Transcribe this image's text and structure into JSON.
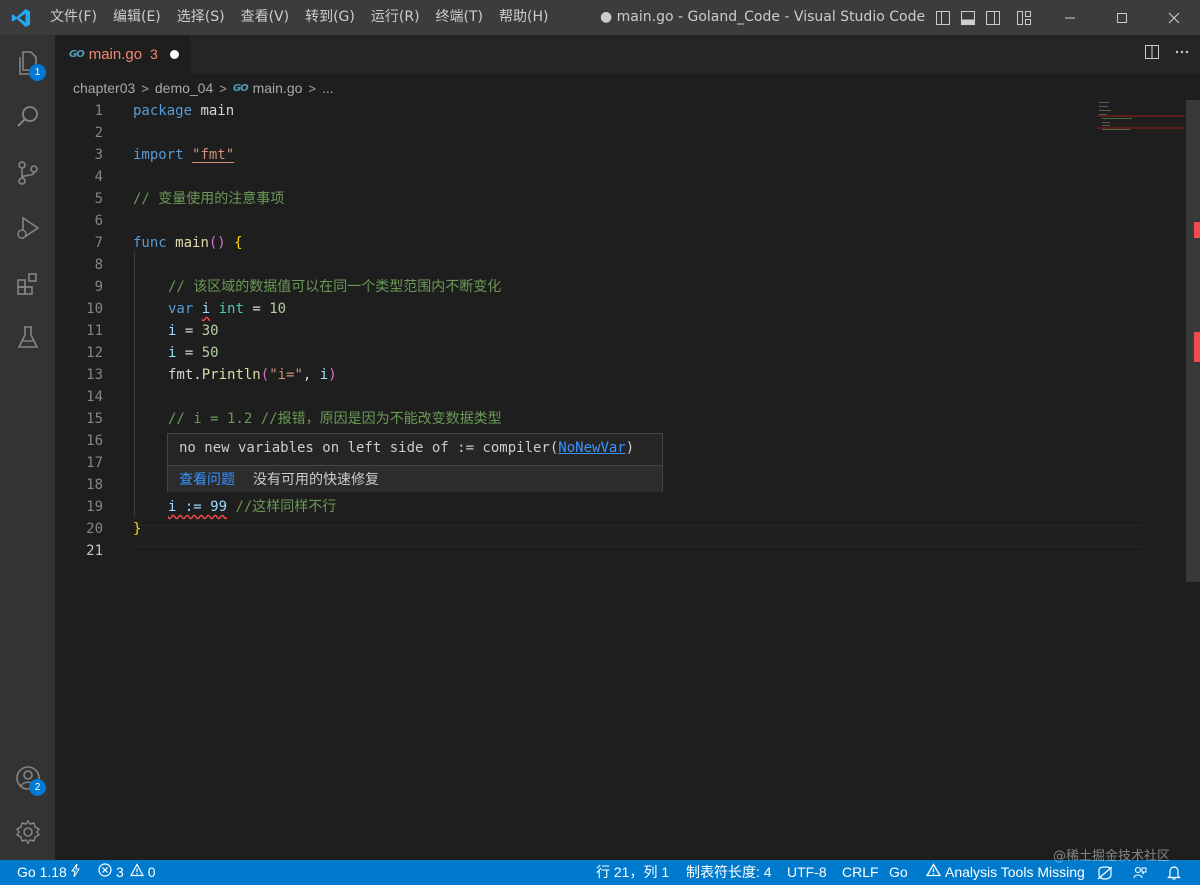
{
  "menubar": {
    "items": [
      "文件(F)",
      "编辑(E)",
      "选择(S)",
      "查看(V)",
      "转到(G)",
      "运行(R)",
      "终端(T)",
      "帮助(H)"
    ]
  },
  "window": {
    "title": "● main.go - Goland_Code - Visual Studio Code [管理..."
  },
  "activity": {
    "explorer_badge": "1",
    "accounts_badge": "2"
  },
  "tab": {
    "label": "main.go",
    "problem_count": "3",
    "file_icon_text": "GO"
  },
  "breadcrumb": {
    "items": [
      "chapter03",
      "demo_04",
      "main.go",
      "..."
    ]
  },
  "editor": {
    "line_numbers": [
      "1",
      "2",
      "3",
      "4",
      "5",
      "6",
      "7",
      "8",
      "9",
      "10",
      "11",
      "12",
      "13",
      "14",
      "15",
      "16",
      "17",
      "18",
      "19",
      "20",
      "21"
    ],
    "active_line": "21",
    "code": {
      "l1_kw": "package",
      "l1_name": "main",
      "l3_kw": "import",
      "l3_str": "\"fmt\"",
      "l5_comment": "// 变量使用的注意事项",
      "l7_kw": "func",
      "l7_fn": "main",
      "l7_rest": "()",
      "l7_brace": "{",
      "l9_comment": "// 该区域的数据值可以在同一个类型范围内不断变化",
      "l10_kw": "var",
      "l10_var": "i",
      "l10_type": "int",
      "l10_rest": " = ",
      "l10_num": "10",
      "l11_var": "i",
      "l11_rest": " = ",
      "l11_num": "30",
      "l12_var": "i",
      "l12_rest": " = ",
      "l12_num": "50",
      "l13_pkg": "fmt",
      "l13_fn": "Println",
      "l13_open": "(",
      "l13_str": "\"i=\"",
      "l13_sep": ", ",
      "l13_var": "i",
      "l13_close": ")",
      "l15_comment": "// i = 1.2 //报错，原因是因为不能改变数据类型",
      "l19_stmt": "i := 99",
      "l19_comment": "//这样同样不行",
      "l20_brace": "}"
    }
  },
  "hover": {
    "message_prefix": "no new variables on left side of := compiler(",
    "message_code": "NoNewVar",
    "message_suffix": ")",
    "view_problem": "查看问题",
    "no_quick_fix": "没有可用的快速修复"
  },
  "statusbar": {
    "go_version": "Go 1.18",
    "errors": "3",
    "warnings": "0",
    "cursor_position": "行 21，列 1",
    "tab_size": "制表符长度: 4",
    "encoding": "UTF-8",
    "eol": "CRLF",
    "language": "Go",
    "analysis_warning": "Analysis Tools Missing"
  },
  "watermark": "@稀土掘金技术社区",
  "colors": {
    "statusbar": "#007acc",
    "titlebar": "#3c3c3c",
    "activitybar": "#333333",
    "editor_bg": "#1e1e1e",
    "error": "#f14c4c",
    "keyword": "#569cd6",
    "comment": "#6a9955",
    "string": "#ce9178"
  },
  "icons": [
    "vscode-logo-icon",
    "explorer-icon",
    "search-icon",
    "source-control-icon",
    "run-debug-icon",
    "extensions-icon",
    "testing-icon",
    "accounts-icon",
    "settings-gear-icon",
    "split-editor-icon",
    "more-actions-icon",
    "minimize-icon",
    "maximize-icon",
    "close-icon",
    "error-icon",
    "warning-icon",
    "feedback-icon",
    "notifications-icon"
  ]
}
